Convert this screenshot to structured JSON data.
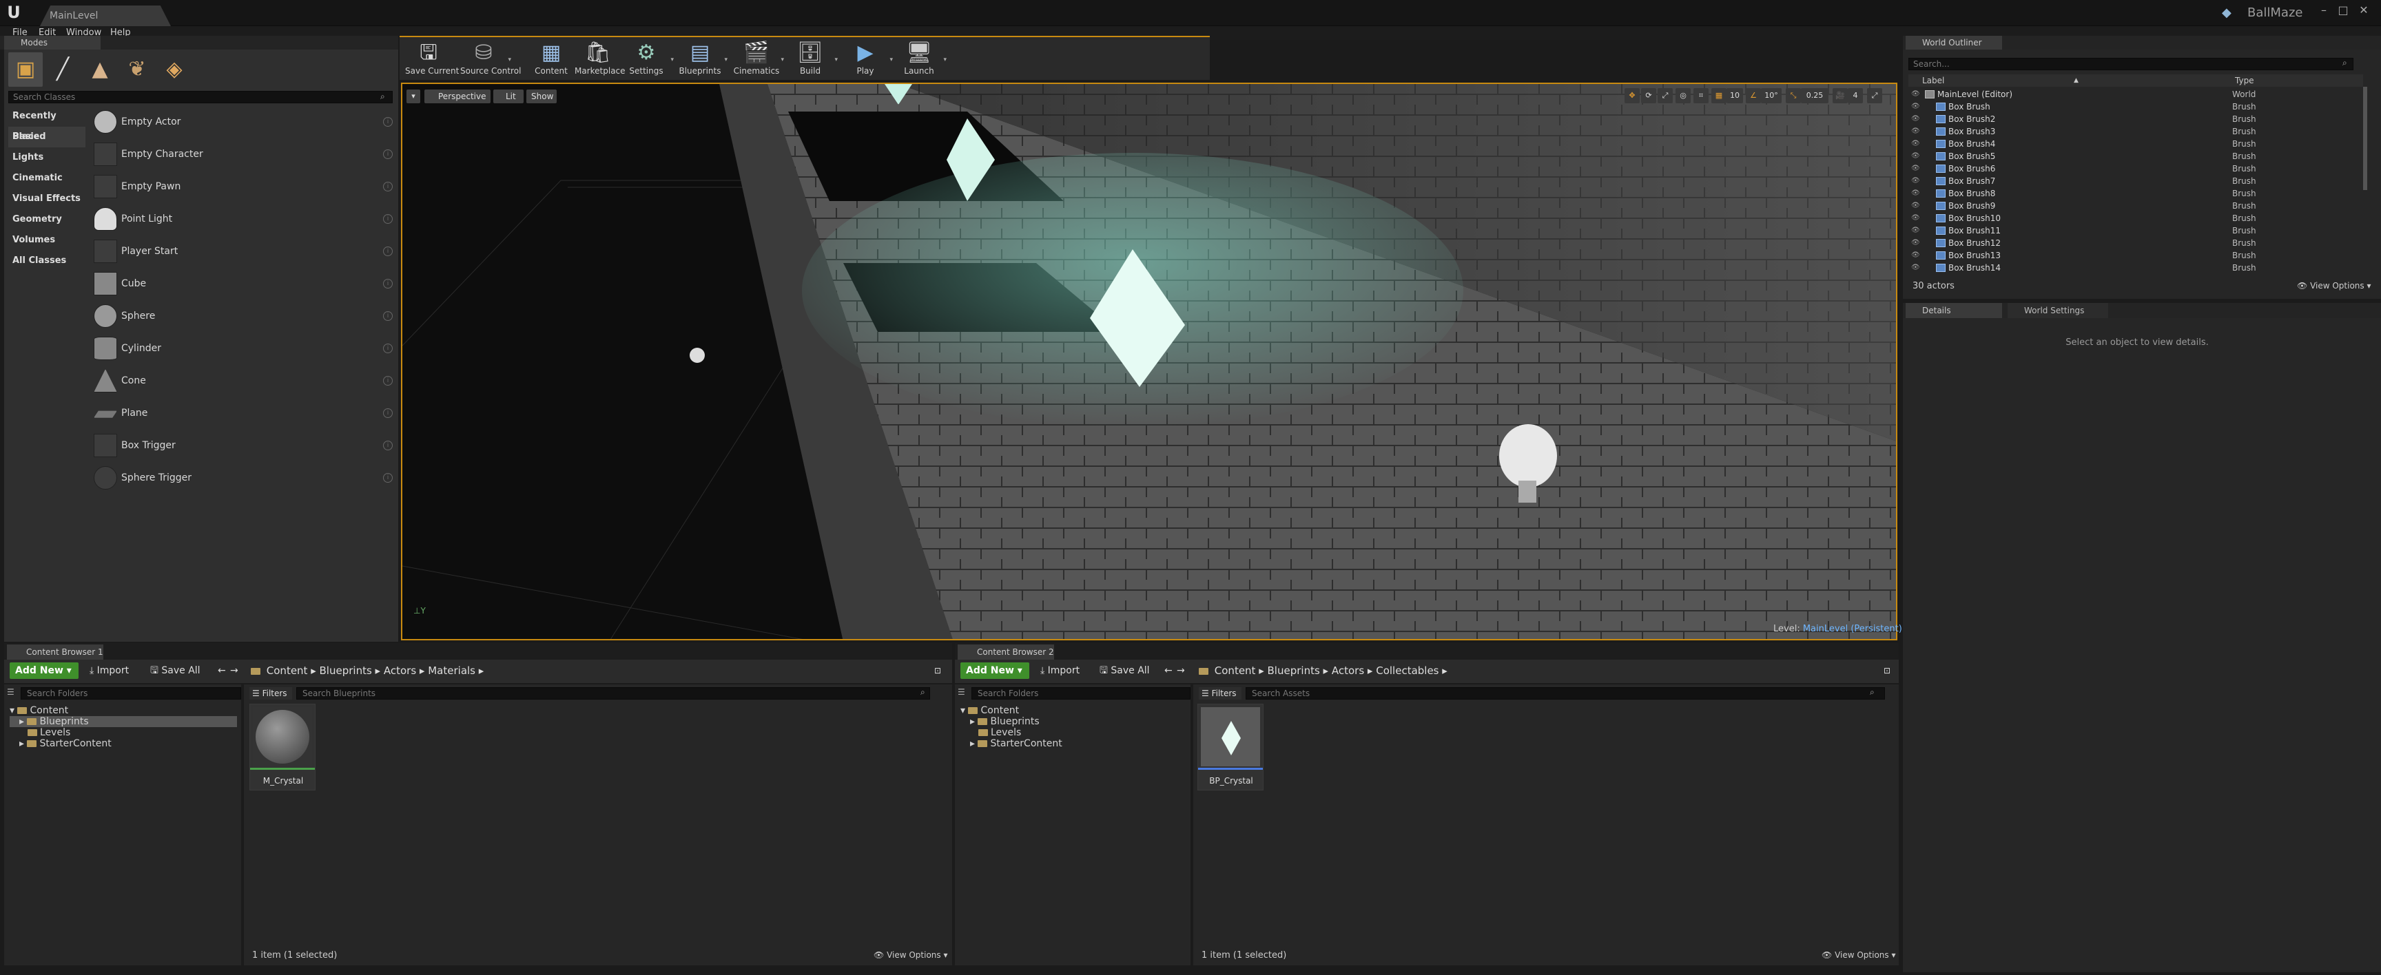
{
  "window": {
    "tab_title": "MainLevel",
    "project": "BallMaze",
    "logo": "U",
    "min": "–",
    "max": "□",
    "close": "✕"
  },
  "menu": [
    "File",
    "Edit",
    "Window",
    "Help"
  ],
  "modes": {
    "tab": "Modes",
    "search_placeholder": "Search Classes",
    "categories": [
      "Recently Placed",
      "Basic",
      "Lights",
      "Cinematic",
      "Visual Effects",
      "Geometry",
      "Volumes",
      "All Classes"
    ],
    "items": [
      "Empty Actor",
      "Empty Character",
      "Empty Pawn",
      "Point Light",
      "Player Start",
      "Cube",
      "Sphere",
      "Cylinder",
      "Cone",
      "Plane",
      "Box Trigger",
      "Sphere Trigger"
    ]
  },
  "toolbar": {
    "save_current": "Save Current",
    "source_control": "Source Control",
    "content": "Content",
    "marketplace": "Marketplace",
    "settings": "Settings",
    "blueprints": "Blueprints",
    "cinematics": "Cinematics",
    "build": "Build",
    "play": "Play",
    "launch": "Launch"
  },
  "viewport": {
    "perspective": "Perspective",
    "lit": "Lit",
    "show": "Show",
    "grid_snap": "10",
    "rot_snap": "10°",
    "scale_snap": "0.25",
    "cam_speed": "4",
    "level_label": "Level:",
    "level_name": "MainLevel (Persistent)"
  },
  "outliner": {
    "tab": "World Outliner",
    "search_placeholder": "Search...",
    "col_label": "Label",
    "col_type": "Type",
    "rows": [
      {
        "name": "MainLevel (Editor)",
        "type": "World"
      },
      {
        "name": "Box Brush",
        "type": "Brush"
      },
      {
        "name": "Box Brush2",
        "type": "Brush"
      },
      {
        "name": "Box Brush3",
        "type": "Brush"
      },
      {
        "name": "Box Brush4",
        "type": "Brush"
      },
      {
        "name": "Box Brush5",
        "type": "Brush"
      },
      {
        "name": "Box Brush6",
        "type": "Brush"
      },
      {
        "name": "Box Brush7",
        "type": "Brush"
      },
      {
        "name": "Box Brush8",
        "type": "Brush"
      },
      {
        "name": "Box Brush9",
        "type": "Brush"
      },
      {
        "name": "Box Brush10",
        "type": "Brush"
      },
      {
        "name": "Box Brush11",
        "type": "Brush"
      },
      {
        "name": "Box Brush12",
        "type": "Brush"
      },
      {
        "name": "Box Brush13",
        "type": "Brush"
      },
      {
        "name": "Box Brush14",
        "type": "Brush"
      }
    ],
    "count": "30 actors",
    "view_options": "View Options"
  },
  "details": {
    "tab": "Details",
    "world_settings_tab": "World Settings",
    "empty_message": "Select an object to view details."
  },
  "cb1": {
    "tab": "Content Browser 1",
    "add_new": "Add New",
    "import": "Import",
    "save_all": "Save All",
    "path": [
      "Content",
      "Blueprints",
      "Actors",
      "Materials"
    ],
    "search_folders": "Search Folders",
    "filters": "Filters",
    "search_assets": "Search Blueprints",
    "tree": [
      "Content",
      "Blueprints",
      "Levels",
      "StarterContent"
    ],
    "asset": "M_Crystal",
    "status": "1 item (1 selected)",
    "view_options": "View Options"
  },
  "cb2": {
    "tab": "Content Browser 2",
    "add_new": "Add New",
    "import": "Import",
    "save_all": "Save All",
    "path": [
      "Content",
      "Blueprints",
      "Actors",
      "Collectables"
    ],
    "search_folders": "Search Folders",
    "filters": "Filters",
    "search_assets": "Search Assets",
    "tree": [
      "Content",
      "Blueprints",
      "Levels",
      "StarterContent"
    ],
    "asset": "BP_Crystal",
    "status": "1 item (1 selected)",
    "view_options": "View Options"
  },
  "colors": {
    "accent": "#c88a10",
    "add_new": "#3f8f2b",
    "level_link": "#6fb6ff"
  }
}
